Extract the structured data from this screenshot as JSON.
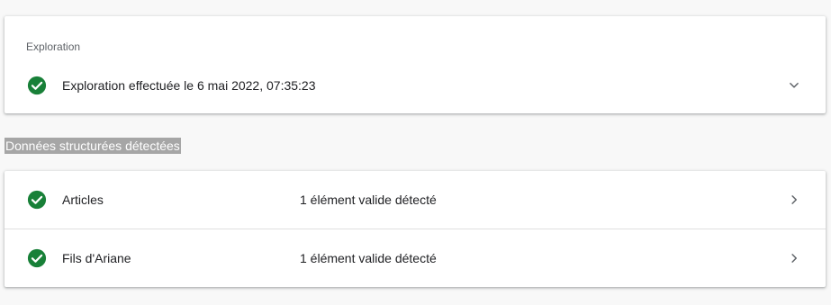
{
  "crawl_section": {
    "label": "Exploration",
    "status_text": "Exploration effectuée le 6 mai 2022, 07:35:23",
    "status_icon": "check-circle-icon",
    "toggle_icon": "chevron-down-icon"
  },
  "structured_data": {
    "heading": "Données structurées détectées",
    "rows": [
      {
        "label": "Articles",
        "status": "1 élément valide détecté",
        "icon": "check-circle-icon",
        "action_icon": "chevron-right-icon"
      },
      {
        "label": "Fils d'Ariane",
        "status": "1 élément valide détecté",
        "icon": "check-circle-icon",
        "action_icon": "chevron-right-icon"
      }
    ]
  },
  "colors": {
    "valid_green": "#188038",
    "text": "#202124",
    "secondary_text": "#5f6368",
    "heading_highlight": "#a6a6a6",
    "icon_gray": "#5f6368"
  }
}
